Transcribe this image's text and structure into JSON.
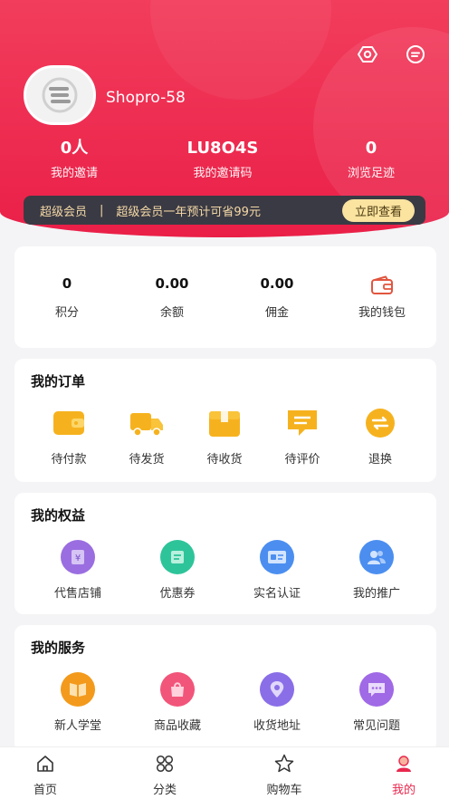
{
  "header": {
    "username": "Shopro-58",
    "stats": [
      {
        "value": "0人",
        "label": "我的邀请"
      },
      {
        "value": "LU8O4S",
        "label": "我的邀请码"
      },
      {
        "value": "0",
        "label": "浏览足迹"
      }
    ],
    "vip": {
      "title": "超级会员",
      "separator": "|",
      "desc": "超级会员一年预计可省99元",
      "button": "立即查看"
    }
  },
  "wallet": [
    {
      "value": "0",
      "label": "积分"
    },
    {
      "value": "0.00",
      "label": "余额"
    },
    {
      "value": "0.00",
      "label": "佣金"
    },
    {
      "value": "",
      "label": "我的钱包"
    }
  ],
  "orders": {
    "title": "我的订单",
    "items": [
      {
        "label": "待付款",
        "icon": "wallet-icon"
      },
      {
        "label": "待发货",
        "icon": "truck-icon"
      },
      {
        "label": "待收货",
        "icon": "box-icon"
      },
      {
        "label": "待评价",
        "icon": "comment-icon"
      },
      {
        "label": "退换",
        "icon": "exchange-icon"
      }
    ]
  },
  "rights": {
    "title": "我的权益",
    "items": [
      {
        "label": "代售店铺",
        "icon": "yen-shop-icon"
      },
      {
        "label": "优惠券",
        "icon": "coupon-icon"
      },
      {
        "label": "实名认证",
        "icon": "id-card-icon"
      },
      {
        "label": "我的推广",
        "icon": "users-icon"
      }
    ]
  },
  "services": {
    "title": "我的服务",
    "items": [
      {
        "label": "新人学堂",
        "icon": "book-icon"
      },
      {
        "label": "商品收藏",
        "icon": "bag-icon"
      },
      {
        "label": "收货地址",
        "icon": "location-icon"
      },
      {
        "label": "常见问题",
        "icon": "chat-icon"
      }
    ]
  },
  "tabbar": [
    {
      "label": "首页",
      "icon": "home-icon"
    },
    {
      "label": "分类",
      "icon": "category-icon"
    },
    {
      "label": "购物车",
      "icon": "star-icon"
    },
    {
      "label": "我的",
      "icon": "profile-icon",
      "active": true
    }
  ],
  "colors": {
    "brand_red": "#ea1f48",
    "order_yellow": "#f6b21e",
    "vip_bg": "#3a3a44",
    "vip_button": "#fbe3a0"
  }
}
